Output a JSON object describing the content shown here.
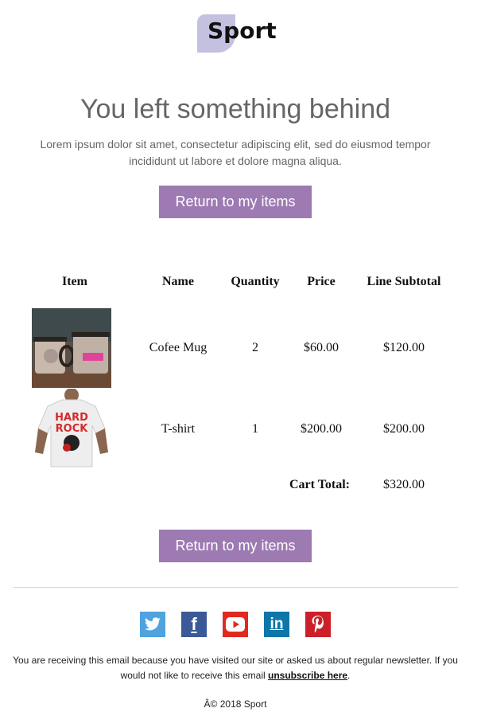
{
  "brand": {
    "name": "Sport",
    "logo_color": "#c4c1e0"
  },
  "hero": {
    "title": "You left something behind",
    "body": "Lorem ipsum dolor sit amet, consectetur adipiscing elit, sed do eiusmod tempor incididunt ut labore et dolore magna aliqua.",
    "cta_top": "Return to my items",
    "cta_bottom": "Return to my items",
    "cta_color": "#9d7ab2"
  },
  "table": {
    "headers": [
      "Item",
      "Name",
      "Quantity",
      "Price",
      "Line Subtotal"
    ],
    "rows": [
      {
        "image": "coffee-mug-photo",
        "name": "Cofee Mug",
        "quantity": "2",
        "price": "$60.00",
        "subtotal": "$120.00"
      },
      {
        "image": "tshirt-photo",
        "name": "T-shirt",
        "quantity": "1",
        "price": "$200.00",
        "subtotal": "$200.00"
      }
    ],
    "total_label": "Cart Total:",
    "total_value": "$320.00"
  },
  "social": [
    {
      "name": "twitter-icon",
      "color": "#4fa3de"
    },
    {
      "name": "facebook-icon",
      "color": "#3b5998"
    },
    {
      "name": "youtube-icon",
      "color": "#e02a20"
    },
    {
      "name": "linkedin-icon",
      "color": "#0e76a8"
    },
    {
      "name": "pinterest-icon",
      "color": "#cb2027"
    }
  ],
  "footer": {
    "text_before": "You are receiving this email because you have visited our site or asked us about regular newsletter. If you would not like to receive this email ",
    "unsubscribe": "unsubscribe here",
    "text_after": ".",
    "copyright": "Â© 2018 Sport"
  }
}
